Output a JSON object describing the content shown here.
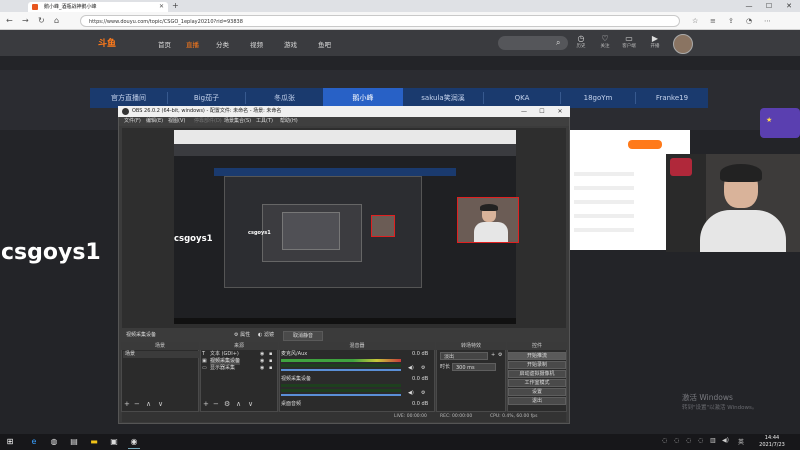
{
  "browser": {
    "tab_title": "鹅小峰_酒瓶战神鹅小峰",
    "url": "https://www.douyu.com/topic/CSGO_1eplay20210?rid=93838",
    "new_tab": "+"
  },
  "site": {
    "logo": "斗鱼",
    "nav": [
      "首页",
      "直播",
      "分类",
      "视频",
      "游戏",
      "鱼吧"
    ],
    "header_icons": [
      "历史",
      "关注",
      "客户端",
      "开播"
    ]
  },
  "streamers": [
    "官方直播间",
    "Big茄子",
    "冬瓜张",
    "鹅小峰",
    "sakula笑润溪",
    "QKA",
    "18goYm",
    "Franke19"
  ],
  "active_streamer_index": 3,
  "overlay_text": "csgoys1",
  "obs": {
    "title": "OBS 26.0.2 (64-bit, windows) - 配置文件: 未命名 - 场景: 未命名",
    "menu": [
      "文件(F)",
      "编辑(E)",
      "视图(V)",
      "停靠部件(D)",
      "场景集合(S)",
      "工具(T)",
      "帮助(H)"
    ],
    "preview_text": "csgoys1",
    "mid_items": [
      "视频采集设备",
      "属性",
      "滤镜",
      "取消静音"
    ],
    "docks": {
      "scenes": {
        "title": "场景",
        "items": [
          "场景"
        ]
      },
      "sources": {
        "title": "来源",
        "items": [
          "文本 (GDI+)",
          "视频采集设备",
          "显示器采集"
        ]
      },
      "mixer": {
        "title": "混音器",
        "channels": [
          {
            "name": "麦克风/Aux",
            "db": "0.0 dB"
          },
          {
            "name": "视频采集设备",
            "db": "0.0 dB"
          },
          {
            "name": "桌面音频",
            "db": "0.0 dB"
          }
        ]
      },
      "transitions": {
        "title": "转场特效",
        "type": "淡出",
        "duration_label": "时长",
        "duration": "300 ms"
      },
      "controls": {
        "title": "控件",
        "buttons": [
          "开始推流",
          "开始录制",
          "启动虚拟摄像机",
          "工作室模式",
          "设置",
          "退出"
        ]
      }
    },
    "status": [
      "LIVE: 00:00:00",
      "REC: 00:00:00",
      "CPU: 0.4%, 60.00 fps"
    ]
  },
  "watermark": {
    "line1": "激活 Windows",
    "line2": "转到\"设置\"以激活 Windows。"
  },
  "clock": {
    "time": "14:44",
    "date": "2021/7/23"
  },
  "colors": {
    "accent": "#ff7a1a",
    "streambar": "#1a3a6e",
    "active_tab": "#2861c6"
  }
}
